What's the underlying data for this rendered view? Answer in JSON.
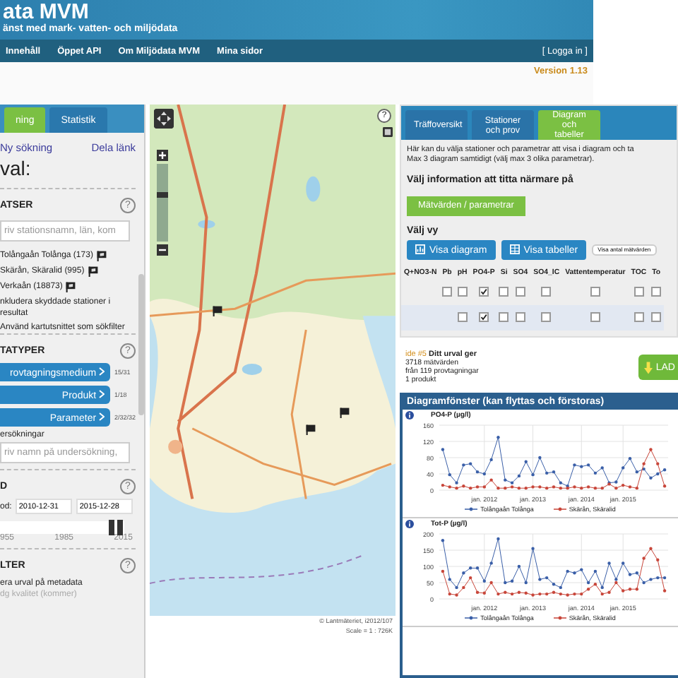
{
  "header": {
    "title": "ata MVM",
    "subtitle": "änst med mark- vatten- och miljödata",
    "nav": [
      "Innehåll",
      "Öppet API",
      "Om Miljödata MVM",
      "Mina sidor"
    ],
    "login": "[ Logga in ]",
    "version": "Version 1.13"
  },
  "left": {
    "tabs": [
      {
        "label": "ning",
        "selected": true
      },
      {
        "label": "Statistik",
        "selected": false
      }
    ],
    "links": [
      "Ny sökning",
      "Dela länk"
    ],
    "heading": "val:",
    "stations": {
      "title": "ATSER",
      "help": "?",
      "placeholder": "riv stationsnamn, län, kom",
      "items": [
        "Tolångaån Tolånga (173)",
        "Skärån, Skäralid (995)",
        "Verkaån (18873)"
      ],
      "options": [
        "nkludera skyddade stationer i resultat",
        "Använd kartutsnittet som sökfilter"
      ]
    },
    "datatypes": {
      "title": "TATYPER",
      "help": "?",
      "buttons": [
        {
          "label": "rovtagningsmedium",
          "count": "15/31"
        },
        {
          "label": "Produkt",
          "count": "1/18"
        },
        {
          "label": "Parameter",
          "count": "2/32/32"
        }
      ],
      "survey_label": "ersökningar",
      "survey_placeholder": "riv namn på undersökning,"
    },
    "period": {
      "title": "D",
      "help": "?",
      "label": "od:",
      "from": "2010-12-31",
      "to": "2015-12-28",
      "handles": [
        {
          "level": 0.9
        },
        {
          "level": 0.97
        }
      ],
      "ticks": [
        "955",
        "1985",
        "2015"
      ]
    },
    "filter": {
      "title": "LTER",
      "help": "?",
      "lines": [
        "era urval på metadata",
        "dg kvalitet (kommer)"
      ]
    }
  },
  "map": {
    "zoom": {
      "level": 0.6
    },
    "attribution": "© Lantmäteriet, i2012/107",
    "scale": "Scale = 1 : 726K"
  },
  "right": {
    "tabs": [
      {
        "label": "Träffoversikt",
        "selected": false
      },
      {
        "label": "Stationer och prov",
        "selected": false
      },
      {
        "label": "Diagram och tabeller",
        "selected": true
      }
    ],
    "intro": [
      "Här kan du välja stationer och parametrar att visa i diagram och ta",
      "Max 3 diagram samtidigt (välj max 3 olika parametrar)."
    ],
    "info_heading": "Välj information att titta närmare på",
    "info_button": "Mätvärden / parametrar",
    "view_heading": "Välj vy",
    "view_buttons": [
      "Visa diagram",
      "Visa tabeller"
    ],
    "count_button": "Visa antal mätvärden",
    "table": {
      "columns": [
        "Q+NO3-N",
        "Pb",
        "pH",
        "PO4-P",
        "Si",
        "SO4",
        "SO4_IC",
        "Vattentemperatur",
        "TOC",
        "To"
      ],
      "rows": [
        {
          "cells": [
            {
              "kind": "empty"
            },
            {
              "kind": "checkbox",
              "checked": false
            },
            {
              "kind": "checkbox",
              "checked": false
            },
            {
              "kind": "checkbox",
              "checked": true
            },
            {
              "kind": "checkbox",
              "checked": false
            },
            {
              "kind": "checkbox",
              "checked": false
            },
            {
              "kind": "checkbox",
              "checked": false
            },
            {
              "kind": "checkbox",
              "checked": false
            },
            {
              "kind": "checkbox",
              "checked": false
            },
            {
              "kind": "checkbox",
              "checked": false
            }
          ]
        },
        {
          "cells": [
            {
              "kind": "empty"
            },
            {
              "kind": "empty"
            },
            {
              "kind": "checkbox",
              "checked": false
            },
            {
              "kind": "checkbox",
              "checked": true
            },
            {
              "kind": "checkbox",
              "checked": false
            },
            {
              "kind": "checkbox",
              "checked": false
            },
            {
              "kind": "checkbox",
              "checked": false
            },
            {
              "kind": "checkbox",
              "checked": false
            },
            {
              "kind": "checkbox",
              "checked": false
            },
            {
              "kind": "checkbox",
              "checked": false
            }
          ]
        }
      ]
    }
  },
  "summary": {
    "tag": "ide #5",
    "title": "Ditt urval ger",
    "lines": [
      "3718 mätvärden",
      "från 119 provtagningar",
      "1 produkt"
    ],
    "button": "LAD"
  },
  "diagrams": {
    "title": "Diagramfönster (kan flyttas och förstoras)",
    "charts": [
      {
        "chart_data": {
          "type": "line",
          "grid": true,
          "title": "PO4-P (µg/l)",
          "categories": [
            null,
            null,
            null,
            null,
            null,
            null,
            "jan. 2012",
            null,
            null,
            null,
            null,
            null,
            null,
            "jan. 2013",
            null,
            null,
            null,
            null,
            null,
            null,
            "jan. 2014",
            null,
            null,
            null,
            null,
            null,
            "jan. 2015",
            null,
            null,
            null,
            null,
            null,
            null
          ],
          "ylim": [
            0,
            160
          ],
          "yticks": [
            0,
            40,
            80,
            120,
            160
          ],
          "series": [
            {
              "name": "Tolångaån Tolånga",
              "color": "#3a5fa8",
              "values": [
                100,
                38,
                18,
                62,
                65,
                45,
                40,
                75,
                130,
                25,
                18,
                35,
                70,
                38,
                80,
                42,
                45,
                18,
                10,
                62,
                58,
                62,
                42,
                55,
                18,
                20,
                55,
                78,
                45,
                52,
                30,
                40,
                50
              ]
            },
            {
              "name": "Skärån, Skäralid",
              "color": "#c8463a",
              "values": [
                12,
                8,
                5,
                10,
                5,
                8,
                8,
                25,
                5,
                5,
                8,
                5,
                5,
                8,
                8,
                5,
                8,
                5,
                5,
                8,
                5,
                8,
                5,
                5,
                15,
                5,
                12,
                8,
                5,
                65,
                100,
                65,
                10
              ]
            }
          ]
        }
      },
      {
        "chart_data": {
          "type": "line",
          "grid": true,
          "title": "Tot-P (µg/l)",
          "categories": [
            null,
            null,
            null,
            null,
            null,
            null,
            "jan. 2012",
            null,
            null,
            null,
            null,
            null,
            null,
            "jan. 2013",
            null,
            null,
            null,
            null,
            null,
            null,
            "jan. 2014",
            null,
            null,
            null,
            null,
            null,
            "jan. 2015",
            null,
            null,
            null,
            null,
            null,
            null
          ],
          "ylim": [
            0,
            200
          ],
          "yticks": [
            0,
            50,
            100,
            150,
            200
          ],
          "series": [
            {
              "name": "Tolångaån Tolånga",
              "color": "#3a5fa8",
              "values": [
                180,
                60,
                35,
                80,
                95,
                95,
                55,
                110,
                185,
                50,
                55,
                100,
                50,
                155,
                60,
                65,
                45,
                35,
                85,
                80,
                90,
                50,
                85,
                35,
                110,
                60,
                110,
                75,
                80,
                50,
                60,
                65,
                65
              ]
            },
            {
              "name": "Skärån, Skäralid",
              "color": "#c8463a",
              "values": [
                85,
                15,
                12,
                35,
                65,
                20,
                18,
                50,
                15,
                20,
                15,
                20,
                18,
                12,
                15,
                15,
                20,
                15,
                12,
                15,
                15,
                30,
                45,
                15,
                20,
                50,
                25,
                30,
                30,
                125,
                155,
                120,
                25
              ]
            }
          ]
        }
      }
    ]
  }
}
